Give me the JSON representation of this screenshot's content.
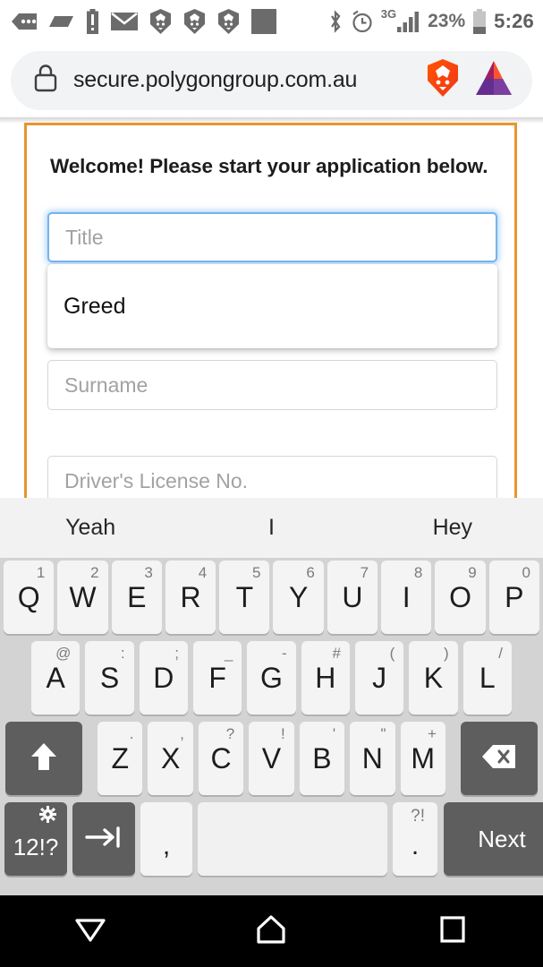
{
  "statusbar": {
    "left_icons": [
      "message-dots-icon",
      "parallelogram-icon",
      "battery-alert-icon",
      "envelope-icon",
      "brave-lion-icon",
      "brave-lion-icon",
      "brave-lion-icon",
      "filled-square-icon"
    ],
    "bluetooth_icon": "bluetooth-icon",
    "alarm_icon": "alarm-clock-icon",
    "network_label": "3G",
    "battery_percent": "23%",
    "time": "5:26"
  },
  "browser": {
    "lock_icon": "lock-icon",
    "url": "secure.polygongroup.com.au",
    "brave_shield_icon": "brave-shield-lion-icon",
    "bat_logo_icon": "bat-triangle-logo-icon"
  },
  "page": {
    "heading": "Welcome! Please start your application below.",
    "frame_color": "#e8952e",
    "fields": [
      {
        "name": "title",
        "placeholder": "Title",
        "value": "",
        "focused": true
      },
      {
        "name": "surname",
        "placeholder": "Surname",
        "value": "",
        "focused": false
      },
      {
        "name": "license",
        "placeholder": "Driver's License No.",
        "value": "",
        "focused": false
      }
    ],
    "autocomplete": {
      "items": [
        "Greed"
      ]
    }
  },
  "keyboard": {
    "suggestions": [
      "Yeah",
      "I",
      "Hey"
    ],
    "row1": [
      {
        "main": "Q",
        "sup": "1"
      },
      {
        "main": "W",
        "sup": "2"
      },
      {
        "main": "E",
        "sup": "3"
      },
      {
        "main": "R",
        "sup": "4"
      },
      {
        "main": "T",
        "sup": "5"
      },
      {
        "main": "Y",
        "sup": "6"
      },
      {
        "main": "U",
        "sup": "7"
      },
      {
        "main": "I",
        "sup": "8"
      },
      {
        "main": "O",
        "sup": "9"
      },
      {
        "main": "P",
        "sup": "0"
      }
    ],
    "row2": [
      {
        "main": "A",
        "sup": "@"
      },
      {
        "main": "S",
        "sup": ":"
      },
      {
        "main": "D",
        "sup": ";"
      },
      {
        "main": "F",
        "sup": "_"
      },
      {
        "main": "G",
        "sup": "-"
      },
      {
        "main": "H",
        "sup": "#"
      },
      {
        "main": "J",
        "sup": "("
      },
      {
        "main": "K",
        "sup": ")"
      },
      {
        "main": "L",
        "sup": "/"
      }
    ],
    "row3": [
      {
        "main": "Z",
        "sup": "."
      },
      {
        "main": "X",
        "sup": ","
      },
      {
        "main": "C",
        "sup": "?"
      },
      {
        "main": "V",
        "sup": "!"
      },
      {
        "main": "B",
        "sup": "'"
      },
      {
        "main": "N",
        "sup": "\""
      },
      {
        "main": "M",
        "sup": "+"
      }
    ],
    "shift_icon": "shift-arrow-up-icon",
    "backspace_icon": "backspace-delete-icon",
    "symbols_key": "12!?",
    "symbols_gear_icon": "gear-icon",
    "tab_icon": "tab-arrow-icon",
    "comma_key": ",",
    "space_key": "",
    "period_key": ".",
    "period_sup": "?!",
    "enter_key": "Next"
  },
  "navbar": {
    "back_icon": "back-triangle-icon",
    "home_icon": "home-icon",
    "recents_icon": "recents-square-icon"
  }
}
